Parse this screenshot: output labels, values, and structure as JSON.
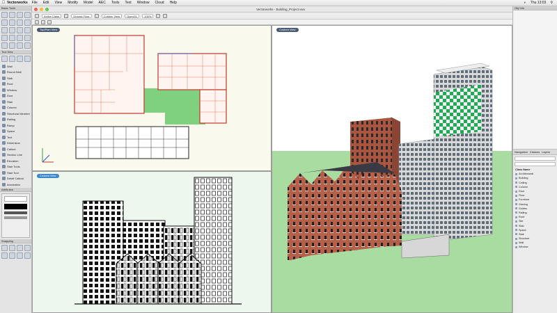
{
  "app": {
    "name": "Vectorworks",
    "menus": [
      "File",
      "Edit",
      "View",
      "Modify",
      "Model",
      "AEC",
      "Tools",
      "Text",
      "Window",
      "Cloud",
      "Help"
    ],
    "clock": "Thu 13:03",
    "window_title": "Vectorworks - Building_Project.vwx"
  },
  "viewbar": {
    "class_field": "Active Class",
    "layer_field": "Ground Floor",
    "view_field": "Custom View",
    "render_field": "OpenGL",
    "zoom": "100%"
  },
  "left_panel": {
    "basic_title": "Basic Tools",
    "tool_set_title": "Tool Sets",
    "tools": [
      "Wall",
      "Round Wall",
      "Slab",
      "Roof",
      "Window",
      "Door",
      "Stair",
      "Column",
      "Structural Member",
      "Railing",
      "Ramp",
      "Space",
      "Text",
      "Dimension",
      "Callout",
      "Section Line",
      "Elevation",
      "Stair Tools",
      "Stair Tool",
      "Detail Callout",
      "Annotation"
    ],
    "attributes_title": "Attributes",
    "snapping_title": "Snapping"
  },
  "right_panel": {
    "title": "Obj Info",
    "tabs": [
      "Navigation",
      "Classes",
      "Layers"
    ],
    "tree_header": "Class Name",
    "tree_items": [
      "Architectural",
      "Building",
      "Ceiling",
      "Column",
      "Door",
      "Floor",
      "Furniture",
      "Glazing",
      "Guides",
      "Railing",
      "Roof",
      "Site",
      "Slab",
      "Space",
      "Stair",
      "Structure",
      "Wall",
      "Window"
    ]
  },
  "viewports": {
    "plan_label": "Top/Plan View",
    "elevation_label": "Custom View",
    "model_label": "Custom View"
  },
  "colors": {
    "plan_bg": "#faf9ee",
    "elevation_bg": "#eef7ee",
    "site_green": "#7fd07f",
    "brick": "#a9553f",
    "accent_green": "#1faa55",
    "sky": "#ffffff"
  }
}
